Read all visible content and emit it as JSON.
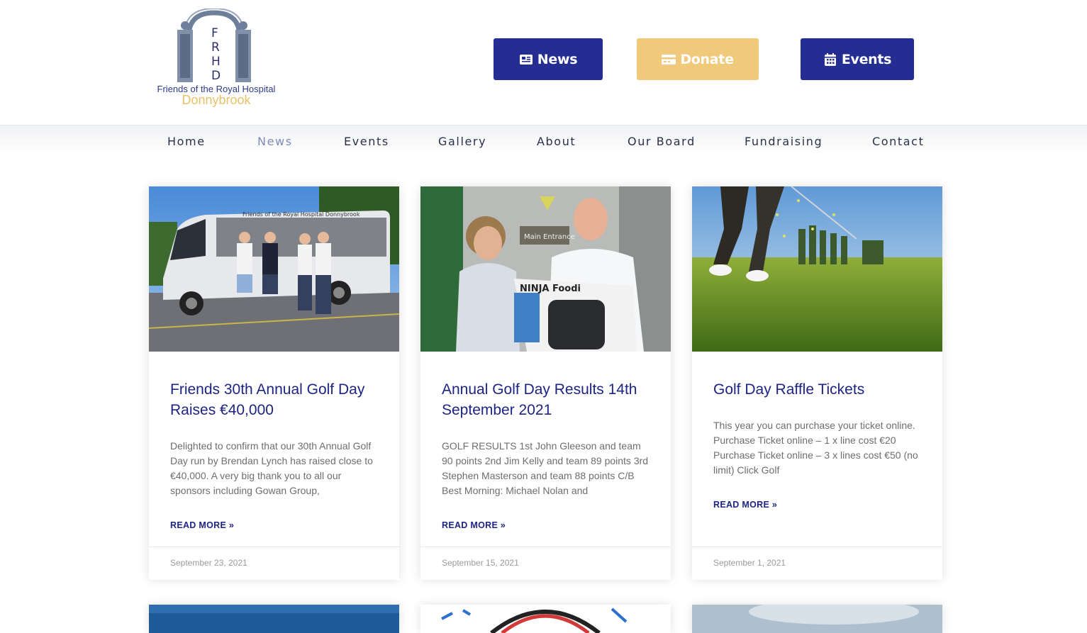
{
  "logo": {
    "letters": [
      "F",
      "R",
      "H",
      "D"
    ],
    "line1": "Friends of the Royal Hospital",
    "line2": "Donnybrook"
  },
  "header_buttons": {
    "news": "News",
    "donate": "Donate",
    "events": "Events"
  },
  "nav": {
    "items": [
      "Home",
      "News",
      "Events",
      "Gallery",
      "About",
      "Our Board",
      "Fundraising",
      "Contact"
    ],
    "active": "News"
  },
  "posts": [
    {
      "title": "Friends 30th Annual Golf Day Raises €40,000",
      "excerpt": "Delighted to confirm that our 30th Annual Golf Day run by Brendan Lynch has raised close to €40,000.  A very big thank you to all our sponsors including Gowan Group,",
      "read_more": "READ MORE »",
      "date": "September 23, 2021",
      "image_caption": "Friends of the Royal Hospital Donnybrook"
    },
    {
      "title": "Annual Golf Day Results 14th September 2021",
      "excerpt": "GOLF RESULTS 1st    John Gleeson and team 90 points 2nd  Jim Kelly and team 89 points 3rd  Stephen Masterson and team 88 points C/B Best Morning:  Michael Nolan and",
      "read_more": "READ MORE »",
      "date": "September 15, 2021",
      "image_sign": "Main Entrance",
      "image_box": "NINJA Foodi"
    },
    {
      "title": "Golf Day Raffle Tickets",
      "excerpt": "This year you can purchase your ticket online. Purchase Ticket online – 1 x line cost €20 Purchase Ticket online – 3 x lines cost €50  (no limit) Click Golf",
      "read_more": "READ MORE »",
      "date": "September 1, 2021"
    }
  ],
  "colors": {
    "brand_navy": "#232d92",
    "donate_gold": "#f0c97b",
    "title_blue": "#1e2484",
    "nav_active": "#7f8bb6"
  }
}
